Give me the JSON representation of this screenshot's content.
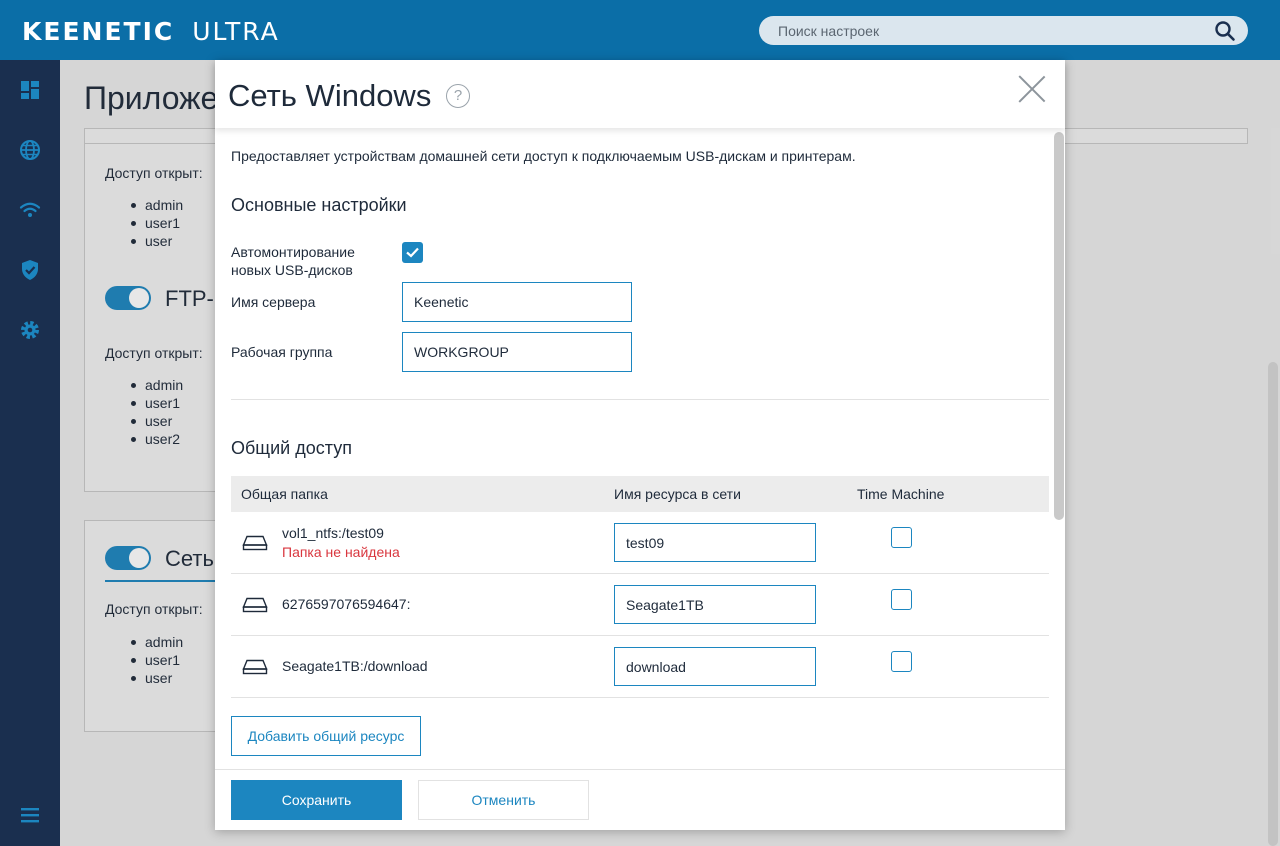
{
  "header": {
    "brand_primary": "KEENETIC",
    "brand_model": "ULTRA",
    "search_placeholder": "Поиск настроек",
    "search_icon": "search-icon"
  },
  "sidebar": {
    "items": [
      {
        "icon": "dashboard-icon"
      },
      {
        "icon": "globe-icon"
      },
      {
        "icon": "wifi-icon"
      },
      {
        "icon": "shield-icon"
      },
      {
        "icon": "gear-icon"
      },
      {
        "icon": "menu-icon"
      }
    ]
  },
  "background": {
    "page_title": "Приложе",
    "cards": [
      {
        "access_label": "Доступ открыт:",
        "users": [
          "admin",
          "user1",
          "user"
        ]
      },
      {
        "service_name": "FTP-",
        "access_label": "Доступ открыт:",
        "users": [
          "admin",
          "user1",
          "user",
          "user2"
        ]
      },
      {
        "service_name": "Сеть",
        "access_label": "Доступ открыт:",
        "users": [
          "admin",
          "user1",
          "user"
        ]
      }
    ]
  },
  "modal": {
    "title": "Сеть Windows",
    "help": "?",
    "description": "Предоставляет устройствам домашней сети доступ к подключаемым USB-дискам и принтерам.",
    "basic_section": "Основные настройки",
    "automount_label": "Автомонтирование новых USB-дисков",
    "automount_checked": true,
    "server_name_label": "Имя сервера",
    "server_name_value": "Keenetic",
    "workgroup_label": "Рабочая группа",
    "workgroup_value": "WORKGROUP",
    "sharing_section": "Общий доступ",
    "table": {
      "columns": [
        "Общая папка",
        "Имя ресурса в сети",
        "Time Machine"
      ],
      "rows": [
        {
          "folder": "vol1_ntfs:/test09",
          "error": "Папка не найдена",
          "share_name": "test09",
          "time_machine": false
        },
        {
          "folder": "6276597076594647:",
          "error": "",
          "share_name": "Seagate1TB",
          "time_machine": false
        },
        {
          "folder": "Seagate1TB:/download",
          "error": "",
          "share_name": "download",
          "time_machine": false
        }
      ]
    },
    "add_share_button": "Добавить общий ресурс",
    "save_button": "Сохранить",
    "cancel_button": "Отменить"
  }
}
